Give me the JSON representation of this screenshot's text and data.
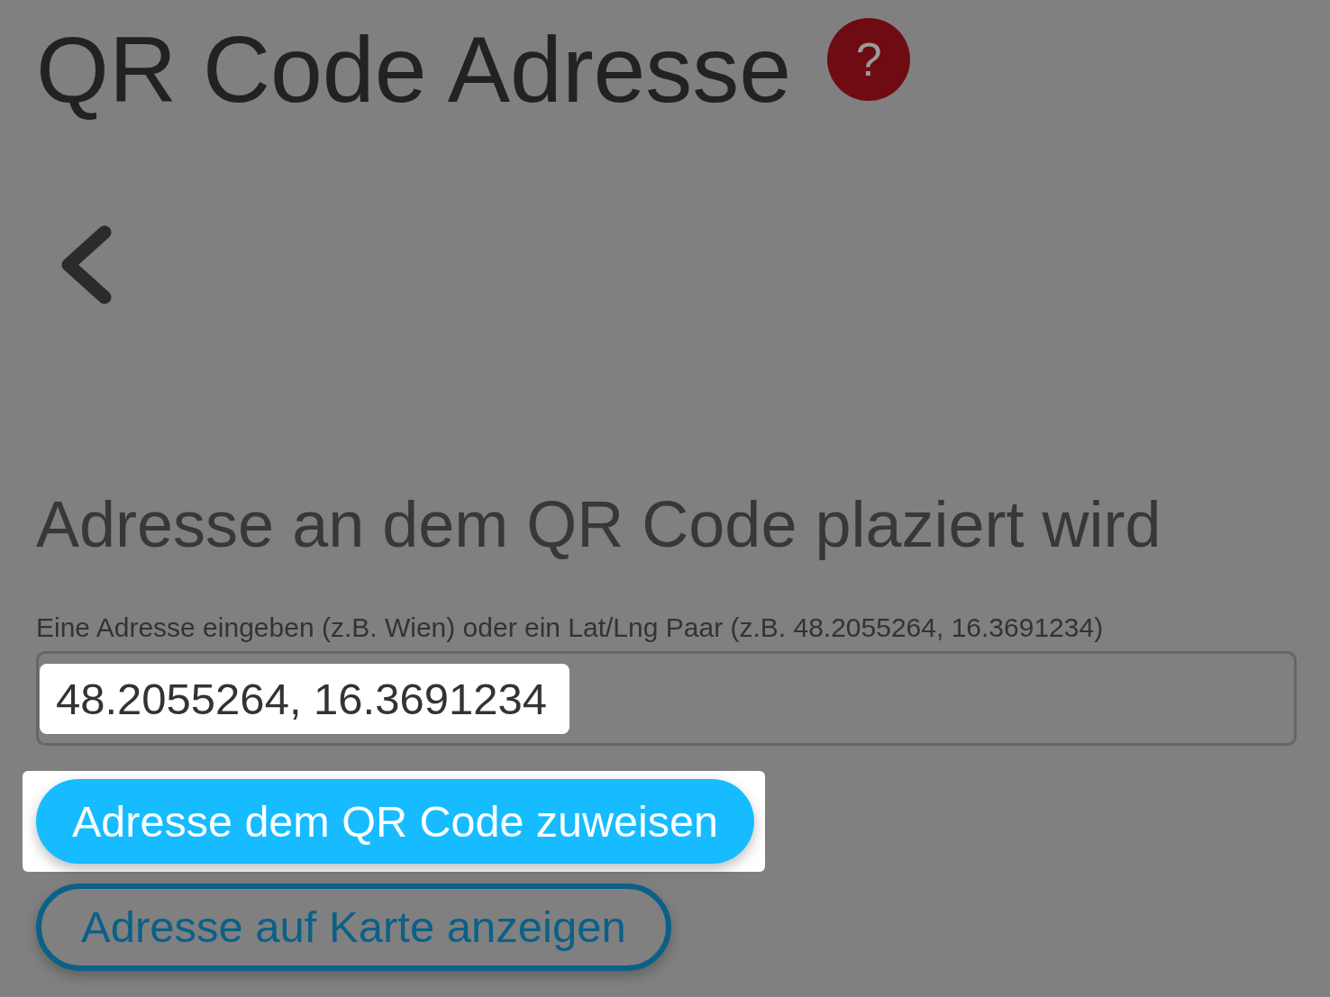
{
  "title": "QR Code Adresse",
  "help_button": {
    "label": "?"
  },
  "section_title": "Adresse an dem QR Code plaziert wird",
  "address_field": {
    "label": "Eine Adresse eingeben (z.B. Wien) oder ein Lat/Lng Paar (z.B. 48.2055264, 16.3691234)",
    "value": "48.2055264, 16.3691234",
    "highlighted": true
  },
  "buttons": [
    {
      "kind": "primary",
      "label": "Adresse dem QR Code zuweisen",
      "highlighted": true
    },
    {
      "kind": "outline",
      "label": "Adresse auf Karte anzeigen",
      "highlighted": false
    }
  ]
}
